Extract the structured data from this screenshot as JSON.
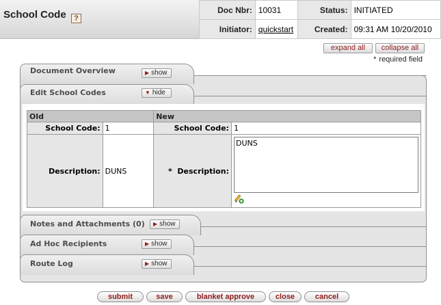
{
  "header": {
    "title": "School Code",
    "help_icon": "?",
    "doc_nbr_label": "Doc Nbr:",
    "doc_nbr": "10031",
    "status_label": "Status:",
    "status": "INITIATED",
    "initiator_label": "Initiator:",
    "initiator": "quickstart",
    "created_label": "Created:",
    "created": "09:31 AM 10/20/2010"
  },
  "controls": {
    "expand_all": "expand all",
    "collapse_all": "collapse all",
    "required_star": "*",
    "required_text": "required field"
  },
  "tabs": {
    "document_overview": {
      "title": "Document Overview",
      "button": "show"
    },
    "edit_school_codes": {
      "title": "Edit School Codes",
      "button": "hide"
    },
    "notes": {
      "title": "Notes and Attachments (0)",
      "button": "show"
    },
    "ad_hoc": {
      "title": "Ad Hoc Recipients",
      "button": "show"
    },
    "route_log": {
      "title": "Route Log",
      "button": "show"
    }
  },
  "edit": {
    "old_header": "Old",
    "new_header": "New",
    "school_code_label": "School Code:",
    "old_school_code": "1",
    "new_school_code": "1",
    "description_label": "Description:",
    "new_description_label": "Description:",
    "required_star": "*",
    "old_description": "DUNS",
    "new_description": "DUNS",
    "lookup_icon": "pencil-lookup-icon"
  },
  "actions": {
    "submit": "submit",
    "save": "save",
    "blanket_approve": "blanket approve",
    "close": "close",
    "cancel": "cancel"
  }
}
